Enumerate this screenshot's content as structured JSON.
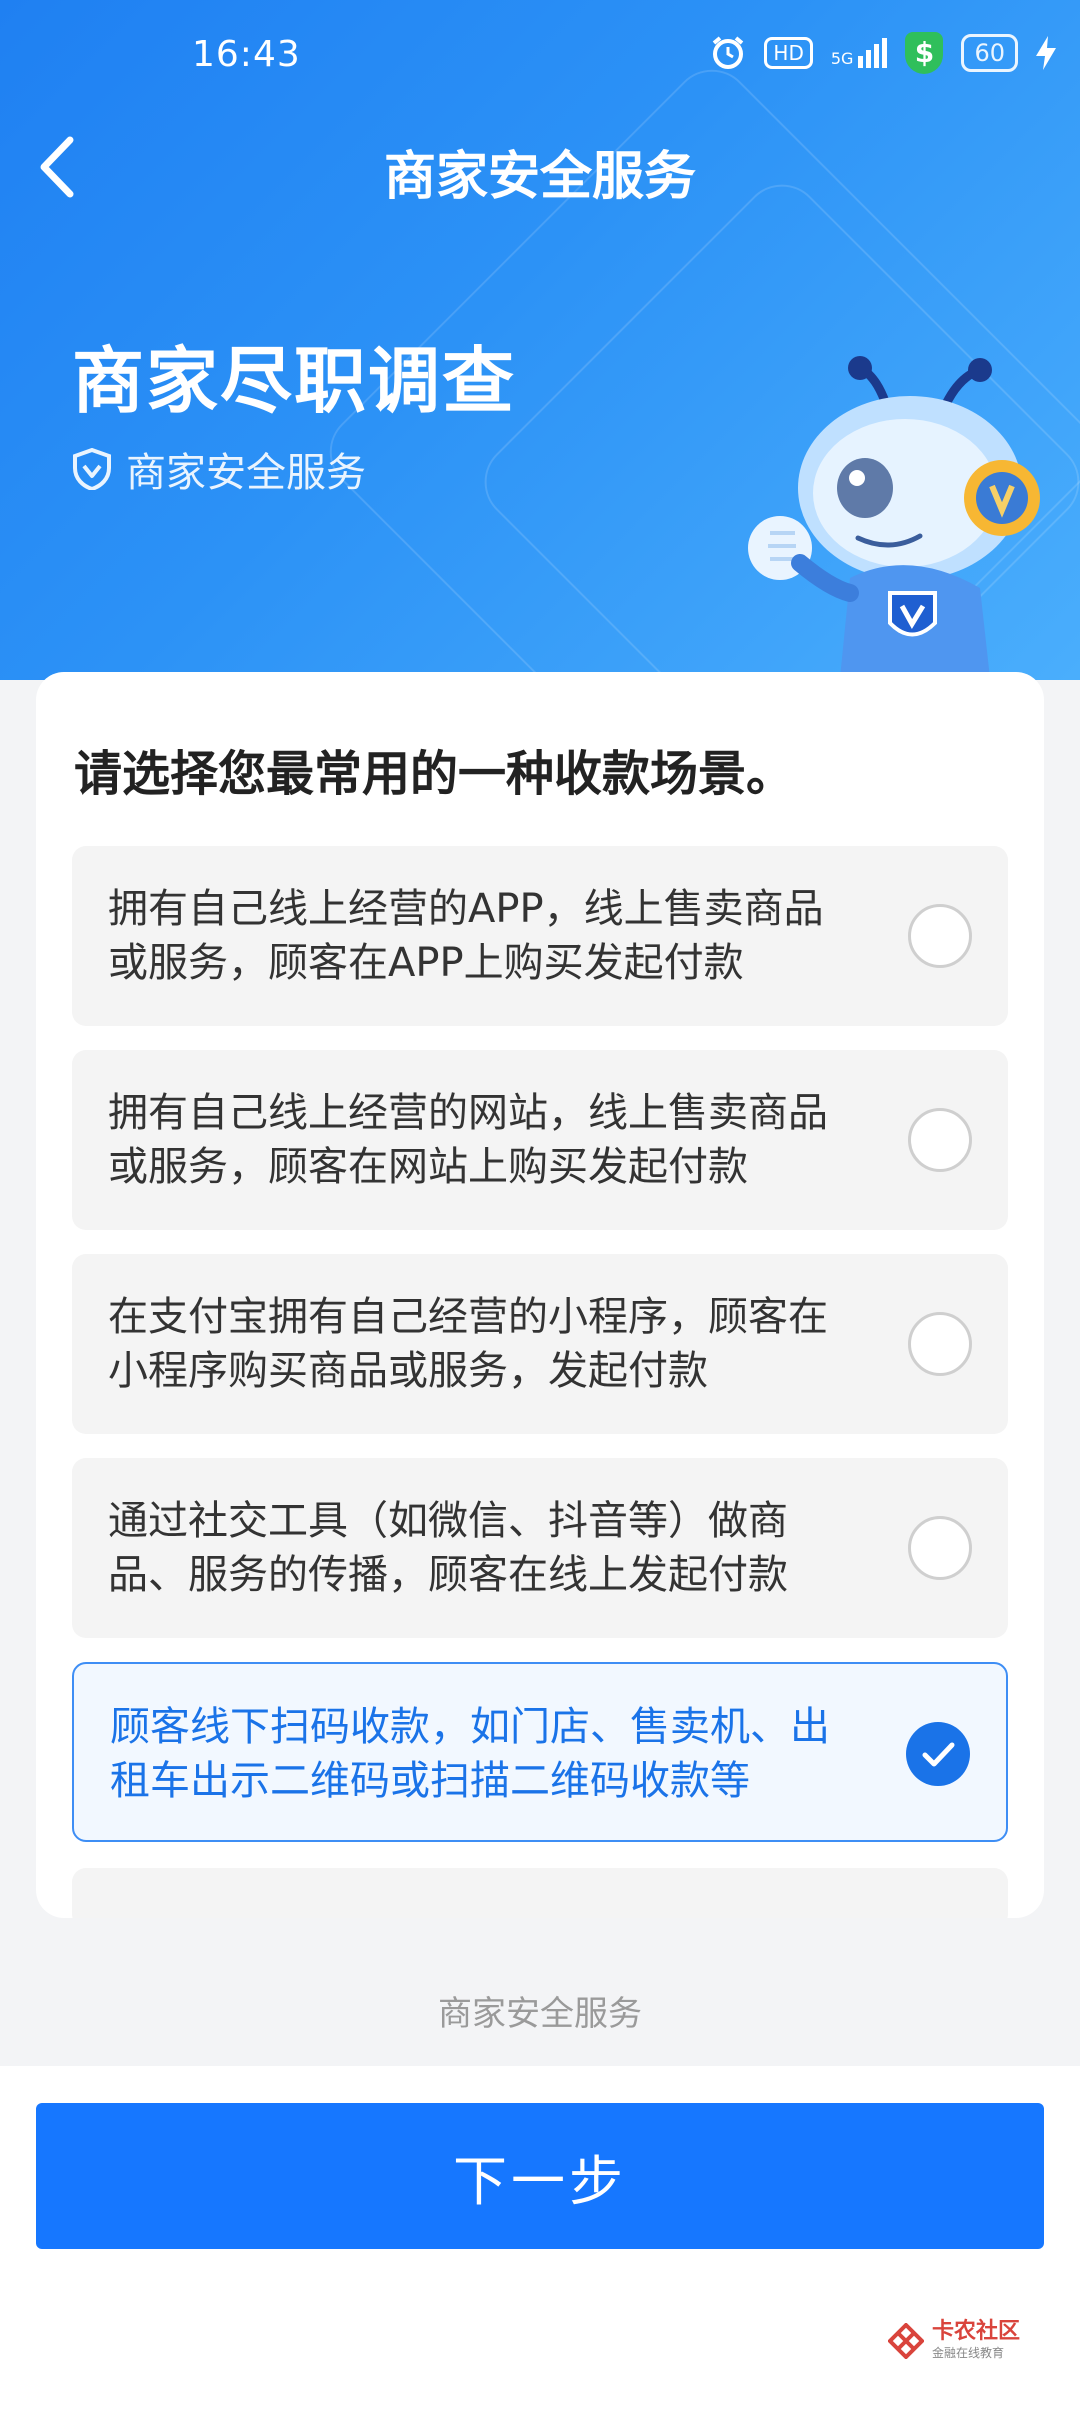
{
  "status_bar": {
    "time": "16:43",
    "hd": "HD",
    "network": "5G",
    "battery": "60"
  },
  "nav": {
    "title": "商家安全服务"
  },
  "hero": {
    "title": "商家尽职调查",
    "subtitle": "商家安全服务"
  },
  "question": "请选择您最常用的一种收款场景。",
  "options": [
    {
      "text": "拥有自己线上经营的APP，线上售卖商品或服务，顾客在APP上购买发起付款",
      "selected": false
    },
    {
      "text": "拥有自己线上经营的网站，线上售卖商品或服务，顾客在网站上购买发起付款",
      "selected": false
    },
    {
      "text": "在支付宝拥有自己经营的小程序，顾客在小程序购买商品或服务，发起付款",
      "selected": false
    },
    {
      "text": "通过社交工具（如微信、抖音等）做商品、服务的传播，顾客在线上发起付款",
      "selected": false
    },
    {
      "text": "顾客线下扫码收款，如门店、售卖机、出租车出示二维码或扫描二维码收款等",
      "selected": true
    }
  ],
  "footer_note": "商家安全服务",
  "next_button": "下一步",
  "watermark": {
    "title": "卡农社区",
    "subtitle": "金融在线教育"
  },
  "colors": {
    "primary": "#1677ff",
    "hero": "#2c92f6",
    "selected_bg": "#f2f8ff"
  }
}
